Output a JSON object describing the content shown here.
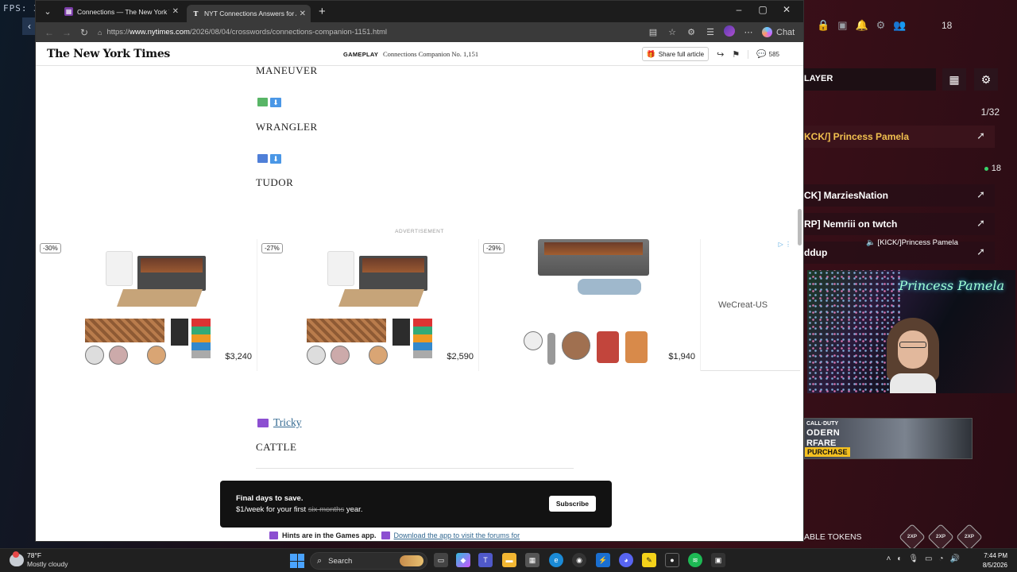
{
  "desktop": {
    "fps_label": "FPS: 3"
  },
  "browser": {
    "tabs": [
      {
        "title": "Connections — The New York Tim",
        "active": false
      },
      {
        "title": "NYT Connections Answers for Aug",
        "active": true
      }
    ],
    "url_prefix": "https://",
    "url_host": "www.nytimes.com",
    "url_path": "/2026/08/04/crosswords/connections-companion-1151.html",
    "chat_label": "Chat"
  },
  "nyt": {
    "logo": "The New York Times",
    "section": "GAMEPLAY",
    "article": "Connections Companion No. 1,151",
    "share_label": "Share full article",
    "comment_count": "585",
    "words": [
      "MANEUVER",
      "WRANGLER",
      "TUDOR",
      "CATTLE"
    ],
    "ad_label": "ADVERTISEMENT",
    "ads": [
      {
        "discount": "-30%",
        "price": "$3,240"
      },
      {
        "discount": "-27%",
        "price": "$2,590"
      },
      {
        "discount": "-29%",
        "price": "$1,940"
      }
    ],
    "ad_brand": "WeCreat-US",
    "category_link": "Tricky",
    "subscribe": {
      "headline": "Final days to save.",
      "offer_prefix": "$1/week for your first",
      "offer_struck": "six months",
      "offer_suffix": "year.",
      "button": "Subscribe"
    },
    "hint_bold": "Hints are in the Games app.",
    "hint_link": "Download the app to visit the forums for"
  },
  "overlay": {
    "top_count": "18",
    "panel_title": "LAYER",
    "page_count": "1/32",
    "players": [
      {
        "name": "KCK/] Princess Pamela"
      },
      {
        "name": "CK] MarziesNation"
      },
      {
        "name": "RP] Nemriii on twtch"
      },
      {
        "name": "ddup"
      }
    ],
    "online_count": "18",
    "speaker_label": "[KICK/]Princess Pamela",
    "neon_name": "Princess Pamela",
    "cod_line1": "CALL·DUTY",
    "cod_line2": "ODERN",
    "cod_line3": "RFARE",
    "cod_line4": "PURCHASE",
    "tokens_label": "ABLE TOKENS",
    "xp_label": "2XP"
  },
  "taskbar": {
    "temp": "78°F",
    "condition": "Mostly cloudy",
    "search_label": "Search",
    "time": "7:44 PM",
    "date": "8/5/2026"
  }
}
